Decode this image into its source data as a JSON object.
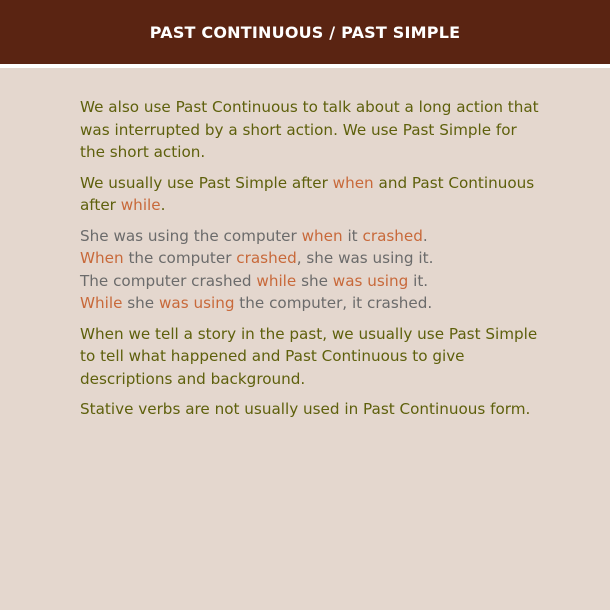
{
  "header": {
    "title": "PAST CONTINUOUS / PAST SIMPLE"
  },
  "content": {
    "para1": "We also use Past Continuous to talk about a long action that was interrupted by a short action. We use Past Simple for the short action.",
    "para2": {
      "part1": "We usually use Past Simple after ",
      "kw1": "when",
      "part2": " and Past Continuous after ",
      "kw2": "while",
      "part3": "."
    },
    "examples": [
      [
        "She was using the computer ",
        "when",
        " it ",
        "crashed",
        "."
      ],
      [
        "When",
        " the computer ",
        "crashed",
        ", she was using it."
      ],
      [
        "The computer crashed ",
        "while",
        " she ",
        "was using",
        " it."
      ],
      [
        "While",
        " she ",
        "was using",
        " the computer, it crashed."
      ]
    ],
    "para3": "When we tell a story in the past, we usually use Past Simple to tell what happened and Past Continuous to give descriptions and background.",
    "para4": "Stative verbs are not usually used in Past Continuous form."
  },
  "colors": {
    "header_bg": "#5a2412",
    "page_bg": "#e4d7ce",
    "body_text": "#5e600c",
    "example_text": "#6b6b6b",
    "highlight": "#c8693a"
  }
}
